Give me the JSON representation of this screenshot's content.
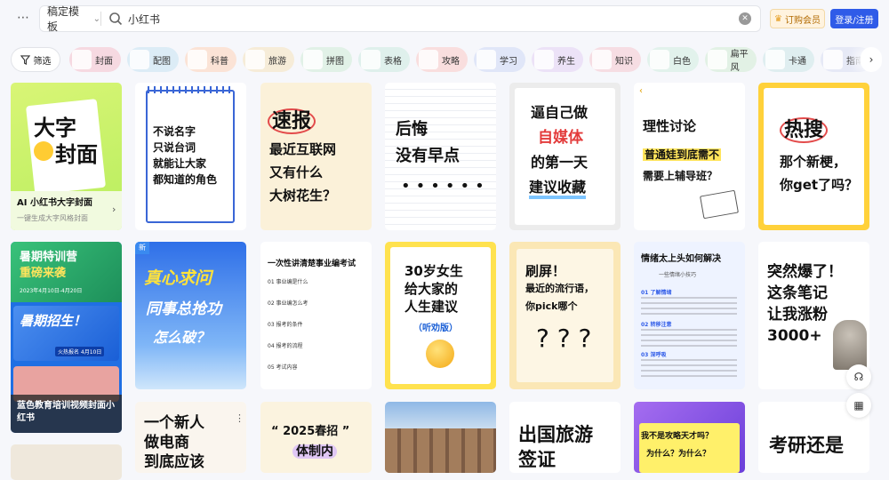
{
  "topbar": {
    "menu_icon": "more-dots-icon",
    "scope": "稿定模板",
    "query": "小红书",
    "vip_label": "订购会员",
    "login_label": "登录/注册"
  },
  "filters": {
    "label": "筛选",
    "chips": [
      "封面",
      "配图",
      "科普",
      "旅游",
      "拼图",
      "表格",
      "攻略",
      "学习",
      "养生",
      "知识",
      "白色",
      "扁平风",
      "卡通",
      "指南"
    ]
  },
  "chip_colors": [
    "#f6d9e1",
    "#dcecf6",
    "#fbe3d6",
    "#f6ecd8",
    "#e1f1e7",
    "#dff0ec",
    "#f9dede",
    "#e0e6f8",
    "#ece2f7",
    "#f6dde3",
    "#e2f2ec",
    "#e2f1e5",
    "#dfeef0",
    "#e6e9f6"
  ],
  "cards": {
    "c1": {
      "title_a": "大字",
      "title_b": "封面",
      "caption": "AI 小红书大字封面",
      "sub": "一键生成大字风格封面"
    },
    "c2": {
      "lines": [
        "不说名字",
        "只说台词",
        "就能让大家",
        "都知道的角色"
      ]
    },
    "c3": {
      "lines": [
        "速报",
        "最近互联网",
        "又有什么",
        "大树花生？"
      ]
    },
    "c4": {
      "lines": [
        "后悔",
        "没有早点"
      ]
    },
    "c5": {
      "lines": [
        "逼自己做",
        "自媒体",
        "的第一天",
        "建议收藏"
      ]
    },
    "c6": {
      "lines": [
        "理性讨论",
        "普通娃到底需不",
        "需要上辅导班？"
      ]
    },
    "c7": {
      "lines": [
        "热搜",
        "那个新梗，",
        "你get了吗？"
      ]
    },
    "c8": {
      "top": "暑期特训营",
      "top2": "重磅来袭",
      "date": "2023年4月10日-4月20日",
      "mid": "暑期招生！",
      "mid_sub": "火热报名 4月10日",
      "caption": "蓝色教育培训视频封面小红书"
    },
    "c9": {
      "badge": "新",
      "lines": [
        "真心求问",
        "同事总抢功",
        "怎么破？"
      ]
    },
    "c10": {
      "title": "一次性讲清楚事业编考试",
      "items": [
        "01 事业编是什么",
        "02 事业编怎么考",
        "03 报考的条件",
        "04 报考的流程",
        "05 考试内容"
      ]
    },
    "c11": {
      "lines": [
        "30岁女生",
        "给大家的",
        "人生建议"
      ],
      "tag": "（听劝版）"
    },
    "c12": {
      "lines": [
        "刷屏！",
        "最近的流行语，",
        "你pick哪个"
      ]
    },
    "c13": {
      "title": "情绪太上头如何解决",
      "sub": "一些情绪小技巧",
      "items": [
        "01 了解情绪",
        "02 转移注意",
        "03 深呼吸"
      ]
    },
    "c14": {
      "lines": [
        "突然爆了！",
        "这条笔记",
        "让我涨粉",
        "3000+"
      ]
    },
    "c15": {
      "lines": [
        "一个新人",
        "做电商",
        "到底应该"
      ]
    },
    "c16": {
      "lines": [
        "“ 2025春招 ”",
        "体制内"
      ]
    },
    "c18": {
      "lines": [
        "出国旅游",
        "签证"
      ]
    },
    "c19": {
      "lines": [
        "我不是攻略天才吗？",
        "为什么？为什么？"
      ]
    },
    "c20": {
      "lines": [
        "考研还是"
      ]
    }
  },
  "side": {
    "help_icon": "headset-icon",
    "grid_icon": "layout-icon"
  }
}
